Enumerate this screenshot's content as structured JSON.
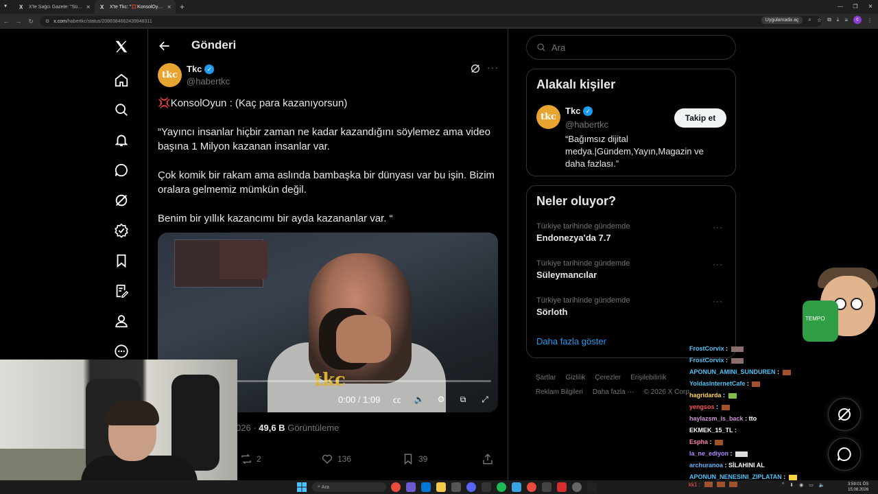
{
  "browser": {
    "tabs": [
      {
        "icon": "X",
        "label": "X'te Sağcı Gazete: \"Süleymancı...",
        "active": false
      },
      {
        "icon": "X",
        "label": "X'te Tkc: \"💢KonsolOyun :...",
        "active": true
      }
    ],
    "url_host": "x.com",
    "url_path": "/habertkc/status/2088384662439948311",
    "open_in_app": "Uygulamada aç",
    "profile_initial": "c"
  },
  "header": {
    "title": "Gönderi"
  },
  "post": {
    "author_name": "Tkc",
    "author_handle": "@habertkc",
    "avatar_text": "tkc",
    "text_line1_icon": "💢",
    "text_line1": "KonsolOyun : (Kaç para kazanıyorsun)",
    "paragraph2": "“Yayıncı insanlar hiçbir zaman ne kadar kazandığını söylemez ama video başına 1 Milyon kazanan insanlar var.",
    "paragraph3": "Çok komik bir rakam ama aslında bambaşka bir dünyası var bu işin. Bizim oralara gelmemiz mümkün değil.",
    "paragraph4": "Benim bir yıllık kazancımı bir ayda kazananlar var. “",
    "video": {
      "logo": "tkc",
      "time": "0:00 / 1:09"
    },
    "date_fragment": "026",
    "views_count": "49,6 B",
    "views_label": "Görüntüleme",
    "reposts": "2",
    "likes": "136",
    "bookmarks": "39"
  },
  "sidebar": {
    "search_placeholder": "Ara",
    "related": {
      "title": "Alakalı kişiler",
      "name": "Tkc",
      "handle": "@habertkc",
      "bio": "“Bağımsız dijital medya.|Gündem,Yayın,Magazin ve daha fazlası.”",
      "follow_label": "Takip et"
    },
    "trends": {
      "title": "Neler oluyor?",
      "items": [
        {
          "context": "Türkiye tarihinde gündemde",
          "name": "Endonezya'da 7.7"
        },
        {
          "context": "Türkiye tarihinde gündemde",
          "name": "Süleymancılar"
        },
        {
          "context": "Türkiye tarihinde gündemde",
          "name": "Sörloth"
        }
      ],
      "show_more": "Daha fazla göster"
    },
    "footer": [
      "Şartlar",
      "Gizlilik",
      "Çerezler",
      "Erişilebilirlik",
      "Reklam Bilgileri",
      "Daha fazla ···",
      "© 2026 X Corp."
    ]
  },
  "chat": [
    {
      "user": "FrostCorvix",
      "color": "#4fc3f7",
      "msg": ":"
    },
    {
      "user": "FrostCorvix",
      "color": "#4fc3f7",
      "msg": ":"
    },
    {
      "user": "APONUN_AMINI_SUNDUREN",
      "color": "#4fc3f7",
      "msg": ":"
    },
    {
      "user": "YoldasInternetCafe",
      "color": "#4fc3f7",
      "msg": ":"
    },
    {
      "user": "hagridarda",
      "color": "#ffd54f",
      "msg": ":"
    },
    {
      "user": "yengsos",
      "color": "#ff5252",
      "msg": ":"
    },
    {
      "user": "haylazsm_is_back",
      "color": "#ce93d8",
      "msg": ": tto"
    },
    {
      "user": "EKMEK_15_TL",
      "color": "#ffffff",
      "msg": ":"
    },
    {
      "user": "Espha",
      "color": "#ff80ab",
      "msg": ":"
    },
    {
      "user": "la_ne_ediyon",
      "color": "#b388ff",
      "msg": ":"
    },
    {
      "user": "archuranoa",
      "color": "#64b5f6",
      "msg": ": SİLAHINI AL"
    },
    {
      "user": "APONUN_NENESINI_ZIPLATAN",
      "color": "#4fc3f7",
      "msg": ":"
    }
  ],
  "chat_tail": "kk1 :",
  "mascot_label": "TEMPO",
  "taskbar": {
    "search": "Ara",
    "time": "3:59:01 ÖS",
    "date": "15.08.2026"
  }
}
